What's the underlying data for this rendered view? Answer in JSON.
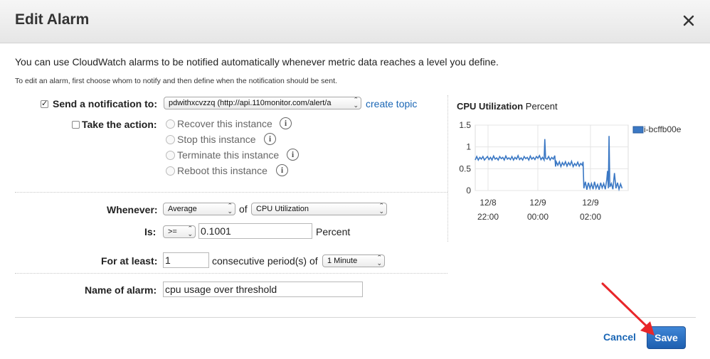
{
  "dialog": {
    "title": "Edit Alarm",
    "close_icon": "close-icon"
  },
  "intro": {
    "line1": "You can use CloudWatch alarms to be notified automatically whenever metric data reaches a level you define.",
    "line2": "To edit an alarm, first choose whom to notify and then define when the notification should be sent."
  },
  "notification": {
    "checked": true,
    "label": "Send a notification to:",
    "topic_value": "pdwithxcvzzq (http://api.110monitor.com/alert/a",
    "create_topic": "create topic"
  },
  "action": {
    "checked": false,
    "label": "Take the action:",
    "options": [
      {
        "label": "Recover this instance"
      },
      {
        "label": "Stop this instance"
      },
      {
        "label": "Terminate this instance"
      },
      {
        "label": "Reboot this instance"
      }
    ],
    "info_glyph": "i"
  },
  "condition": {
    "whenever_label": "Whenever:",
    "statistic": "Average",
    "of_text": "of",
    "metric": "CPU Utilization",
    "is_label": "Is:",
    "operator": ">=",
    "threshold": "0.1001",
    "unit": "Percent",
    "for_at_least_label": "For at least:",
    "periods": "1",
    "consecutive_text": "consecutive period(s) of",
    "period": "1 Minute",
    "name_label": "Name of alarm:",
    "name_value": "cpu usage over threshold"
  },
  "footer": {
    "cancel": "Cancel",
    "save": "Save"
  },
  "colors": {
    "accent": "#1a66b5",
    "series": "#3b78c4",
    "arrow": "#e8262a"
  },
  "chart_data": {
    "type": "line",
    "title": "CPU Utilization",
    "title_unit": "Percent",
    "xlabel": "",
    "ylabel": "",
    "ylim": [
      0,
      1.5
    ],
    "yticks": [
      "1.5",
      "1",
      "0.5",
      "0"
    ],
    "xticks": [
      {
        "line1": "12/8",
        "line2": "22:00"
      },
      {
        "line1": "12/9",
        "line2": "00:00"
      },
      {
        "line1": "12/9",
        "line2": "02:00"
      }
    ],
    "grid": true,
    "legend_position": "right",
    "series": [
      {
        "name": "i-bcffb00e",
        "points": [
          [
            0.0,
            0.7
          ],
          [
            0.01,
            0.78
          ],
          [
            0.02,
            0.7
          ],
          [
            0.03,
            0.76
          ],
          [
            0.04,
            0.72
          ],
          [
            0.05,
            0.78
          ],
          [
            0.06,
            0.7
          ],
          [
            0.07,
            0.74
          ],
          [
            0.08,
            0.78
          ],
          [
            0.09,
            0.71
          ],
          [
            0.1,
            0.76
          ],
          [
            0.11,
            0.7
          ],
          [
            0.12,
            0.79
          ],
          [
            0.13,
            0.72
          ],
          [
            0.14,
            0.75
          ],
          [
            0.15,
            0.7
          ],
          [
            0.16,
            0.78
          ],
          [
            0.17,
            0.73
          ],
          [
            0.18,
            0.76
          ],
          [
            0.19,
            0.7
          ],
          [
            0.2,
            0.79
          ],
          [
            0.21,
            0.72
          ],
          [
            0.22,
            0.75
          ],
          [
            0.23,
            0.71
          ],
          [
            0.24,
            0.78
          ],
          [
            0.25,
            0.7
          ],
          [
            0.26,
            0.76
          ],
          [
            0.27,
            0.72
          ],
          [
            0.28,
            0.8
          ],
          [
            0.29,
            0.71
          ],
          [
            0.3,
            0.75
          ],
          [
            0.31,
            0.7
          ],
          [
            0.32,
            0.78
          ],
          [
            0.33,
            0.73
          ],
          [
            0.34,
            0.76
          ],
          [
            0.35,
            0.7
          ],
          [
            0.36,
            0.79
          ],
          [
            0.37,
            0.72
          ],
          [
            0.38,
            0.76
          ],
          [
            0.39,
            0.71
          ],
          [
            0.4,
            0.78
          ],
          [
            0.41,
            0.74
          ],
          [
            0.42,
            0.8
          ],
          [
            0.43,
            0.71
          ],
          [
            0.44,
            0.76
          ],
          [
            0.45,
            0.7
          ],
          [
            0.455,
            1.18
          ],
          [
            0.46,
            0.74
          ],
          [
            0.47,
            0.72
          ],
          [
            0.48,
            0.78
          ],
          [
            0.49,
            0.7
          ],
          [
            0.5,
            0.76
          ],
          [
            0.51,
            0.72
          ],
          [
            0.52,
            0.8
          ],
          [
            0.525,
            0.55
          ],
          [
            0.53,
            0.66
          ],
          [
            0.54,
            0.58
          ],
          [
            0.55,
            0.66
          ],
          [
            0.56,
            0.55
          ],
          [
            0.57,
            0.64
          ],
          [
            0.58,
            0.58
          ],
          [
            0.59,
            0.66
          ],
          [
            0.6,
            0.56
          ],
          [
            0.61,
            0.64
          ],
          [
            0.62,
            0.58
          ],
          [
            0.63,
            0.67
          ],
          [
            0.64,
            0.55
          ],
          [
            0.65,
            0.62
          ],
          [
            0.66,
            0.57
          ],
          [
            0.67,
            0.65
          ],
          [
            0.68,
            0.56
          ],
          [
            0.69,
            0.62
          ],
          [
            0.7,
            0.58
          ],
          [
            0.705,
            0.66
          ],
          [
            0.71,
            0.05
          ],
          [
            0.72,
            0.2
          ],
          [
            0.73,
            0.02
          ],
          [
            0.74,
            0.18
          ],
          [
            0.75,
            0.05
          ],
          [
            0.76,
            0.16
          ],
          [
            0.77,
            0.03
          ],
          [
            0.78,
            0.2
          ],
          [
            0.79,
            0.05
          ],
          [
            0.8,
            0.14
          ],
          [
            0.81,
            0.02
          ],
          [
            0.82,
            0.18
          ],
          [
            0.83,
            0.06
          ],
          [
            0.84,
            0.16
          ],
          [
            0.85,
            0.03
          ],
          [
            0.86,
            0.25
          ],
          [
            0.865,
            0.45
          ],
          [
            0.87,
            0.05
          ],
          [
            0.875,
            1.25
          ],
          [
            0.88,
            0.08
          ],
          [
            0.89,
            0.16
          ],
          [
            0.9,
            0.03
          ],
          [
            0.91,
            0.4
          ],
          [
            0.92,
            0.05
          ],
          [
            0.93,
            0.18
          ],
          [
            0.94,
            0.03
          ],
          [
            0.95,
            0.15
          ],
          [
            0.96,
            0.05
          ]
        ]
      }
    ]
  }
}
